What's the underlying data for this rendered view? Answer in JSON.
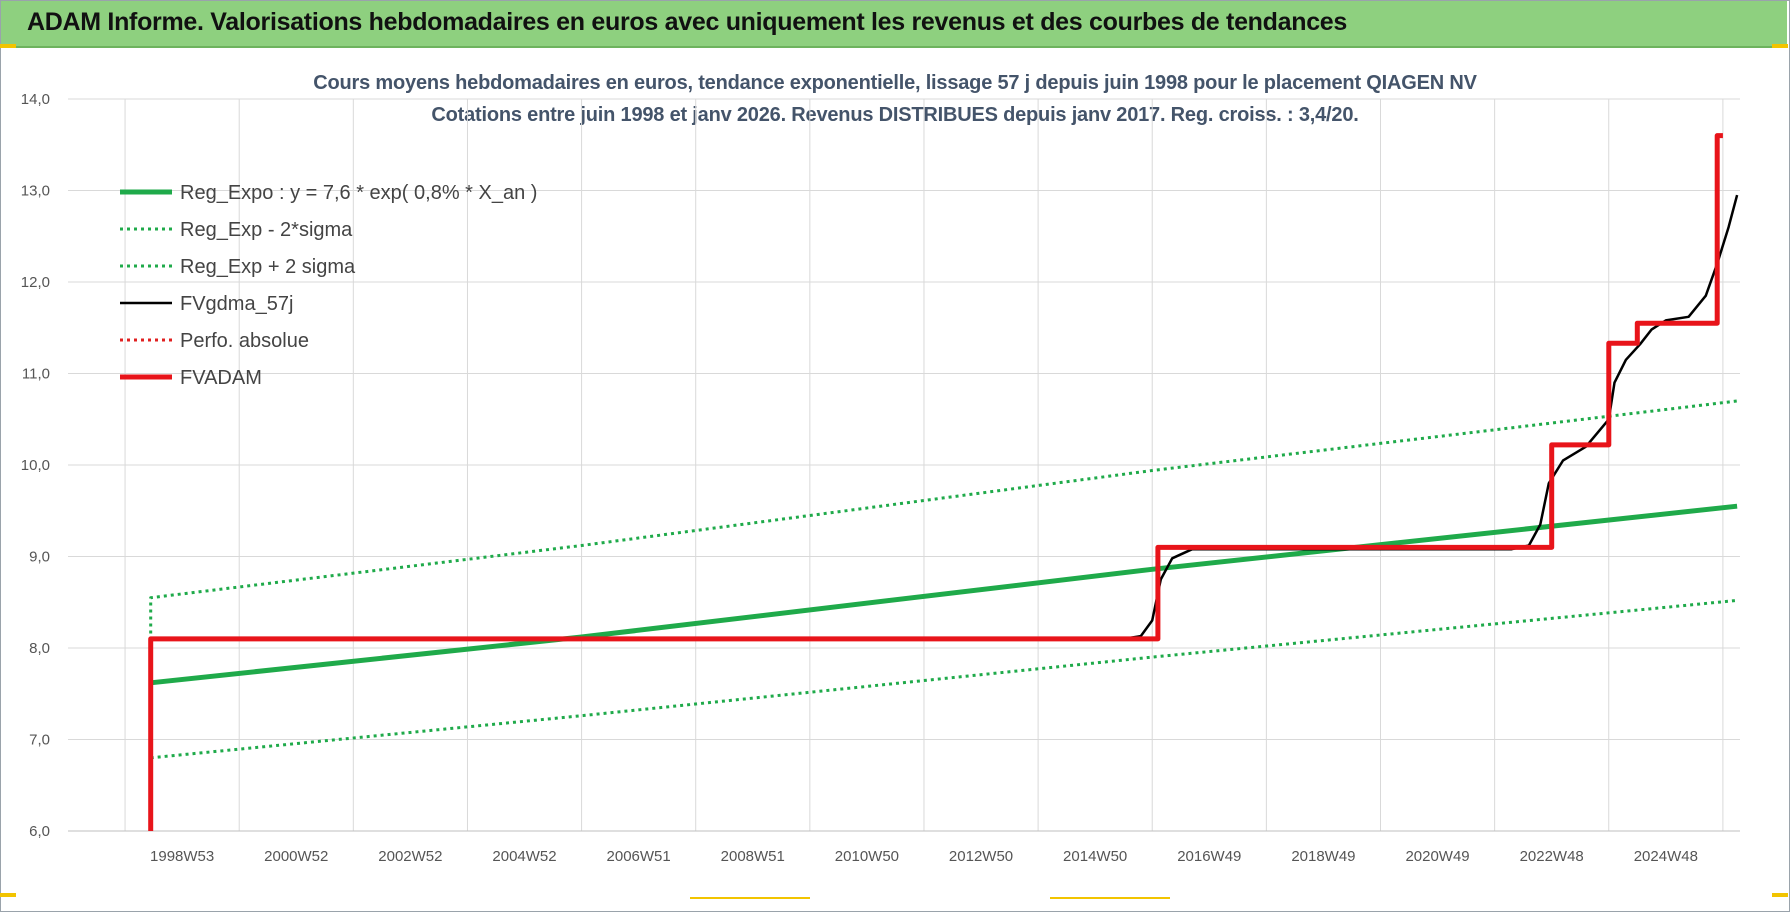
{
  "banner": {
    "title": "ADAM Informe. Valorisations hebdomadaires en euros avec uniquement les revenus et des courbes de tendances"
  },
  "chart_data": {
    "type": "line",
    "title": "Cours moyens hebdomadaires en euros, tendance exponentielle, lissage 57 j depuis juin 1998 pour le placement QIAGEN NV",
    "subtitle": "Cotations entre juin 1998 et janv 2026. Revenus DISTRIBUES depuis janv 2017. Reg. croiss. : 3,4/20.",
    "xlabel": "",
    "ylabel": "",
    "ylim": [
      6.0,
      14.0
    ],
    "y_ticks": [
      "6,0",
      "7,0",
      "8,0",
      "9,0",
      "10,0",
      "11,0",
      "12,0",
      "13,0",
      "14,0"
    ],
    "x_range": [
      1997.0,
      2026.3
    ],
    "x_ticks": [
      {
        "label": "1998W53",
        "x": 1999.0
      },
      {
        "label": "2000W52",
        "x": 2001.0
      },
      {
        "label": "2002W52",
        "x": 2003.0
      },
      {
        "label": "2004W52",
        "x": 2005.0
      },
      {
        "label": "2006W51",
        "x": 2007.0
      },
      {
        "label": "2008W51",
        "x": 2009.0
      },
      {
        "label": "2010W50",
        "x": 2011.0
      },
      {
        "label": "2012W50",
        "x": 2013.0
      },
      {
        "label": "2014W50",
        "x": 2015.0
      },
      {
        "label": "2016W49",
        "x": 2017.0
      },
      {
        "label": "2018W49",
        "x": 2019.0
      },
      {
        "label": "2020W49",
        "x": 2021.0
      },
      {
        "label": "2022W48",
        "x": 2023.0
      },
      {
        "label": "2024W48",
        "x": 2025.0
      }
    ],
    "grid": true,
    "legend_position": "top-left",
    "series": [
      {
        "name": "Reg_Expo : y = 7,6 * exp( 0,8% *  X_an )",
        "color": "#1faa4a",
        "style": "solid-thick",
        "points": [
          [
            1998.45,
            7.62
          ],
          [
            2006.0,
            8.12
          ],
          [
            2016.0,
            8.86
          ],
          [
            2026.25,
            9.55
          ]
        ]
      },
      {
        "name": "Reg_Exp - 2*sigma",
        "color": "#1faa4a",
        "style": "dotted",
        "points": [
          [
            1998.45,
            6.8
          ],
          [
            2006.0,
            7.26
          ],
          [
            2016.0,
            7.9
          ],
          [
            2026.25,
            8.52
          ]
        ]
      },
      {
        "name": "Reg_Exp + 2 sigma",
        "color": "#1faa4a",
        "style": "dotted",
        "points": [
          [
            1998.45,
            7.7
          ],
          [
            1998.45,
            8.55
          ],
          [
            2006.0,
            9.12
          ],
          [
            2016.0,
            9.94
          ],
          [
            2026.25,
            10.7
          ]
        ]
      },
      {
        "name": "FVgdma_57j",
        "color": "#000000",
        "style": "solid",
        "points": [
          [
            1998.45,
            8.1
          ],
          [
            2015.5,
            8.1
          ],
          [
            2015.8,
            8.13
          ],
          [
            2016.0,
            8.3
          ],
          [
            2016.15,
            8.75
          ],
          [
            2016.35,
            8.98
          ],
          [
            2016.7,
            9.08
          ],
          [
            2022.3,
            9.08
          ],
          [
            2022.6,
            9.12
          ],
          [
            2022.8,
            9.35
          ],
          [
            2022.95,
            9.8
          ],
          [
            2023.2,
            10.05
          ],
          [
            2023.6,
            10.2
          ],
          [
            2024.0,
            10.5
          ],
          [
            2024.1,
            10.9
          ],
          [
            2024.3,
            11.15
          ],
          [
            2024.55,
            11.32
          ],
          [
            2024.75,
            11.48
          ],
          [
            2025.0,
            11.58
          ],
          [
            2025.4,
            11.62
          ],
          [
            2025.7,
            11.85
          ],
          [
            2025.9,
            12.2
          ],
          [
            2026.1,
            12.6
          ],
          [
            2026.25,
            12.95
          ]
        ]
      },
      {
        "name": "Perfo. absolue",
        "color": "#e02020",
        "style": "dotted",
        "points": []
      },
      {
        "name": "FVADAM",
        "color": "#e8141a",
        "style": "solid-thick",
        "points": [
          [
            1998.45,
            6.0
          ],
          [
            1998.45,
            8.1
          ],
          [
            2016.1,
            8.1
          ],
          [
            2016.1,
            9.1
          ],
          [
            2023.0,
            9.1
          ],
          [
            2023.0,
            10.22
          ],
          [
            2024.0,
            10.22
          ],
          [
            2024.0,
            11.33
          ],
          [
            2024.5,
            11.33
          ],
          [
            2024.5,
            11.55
          ],
          [
            2025.9,
            11.55
          ],
          [
            2025.9,
            13.6
          ],
          [
            2026.0,
            13.6
          ]
        ]
      }
    ]
  }
}
